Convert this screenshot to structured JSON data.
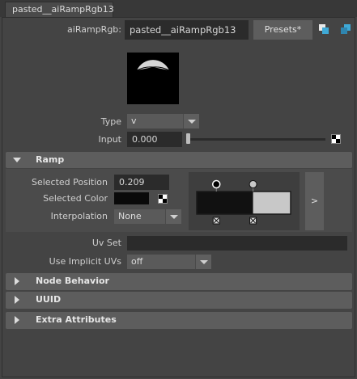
{
  "tab": {
    "title": "pasted__aiRampRgb13"
  },
  "node": {
    "label": "aiRampRgb:",
    "name": "pasted__aiRampRgb13",
    "presets_label": "Presets*"
  },
  "icons": {
    "show_left": "show-left-icon",
    "show_right": "show-right-icon"
  },
  "type": {
    "label": "Type",
    "value": "v"
  },
  "input": {
    "label": "Input",
    "value": "0.000",
    "slider_fraction": 0.0
  },
  "ramp_section": {
    "title": "Ramp",
    "selected_position_label": "Selected Position",
    "selected_position_value": "0.209",
    "selected_color_label": "Selected Color",
    "selected_color": "#0a0a0a",
    "interpolation_label": "Interpolation",
    "interpolation_value": "None",
    "expand_label": ">",
    "stops": [
      {
        "position": 0.209,
        "color": "#111111",
        "selected": true
      },
      {
        "position": 0.6,
        "color": "#c8c8c8",
        "selected": false
      }
    ]
  },
  "uv_set": {
    "label": "Uv Set",
    "value": ""
  },
  "use_implicit_uvs": {
    "label": "Use Implicit UVs",
    "value": "off"
  },
  "sections": [
    {
      "title": "Node Behavior"
    },
    {
      "title": "UUID"
    },
    {
      "title": "Extra Attributes"
    }
  ]
}
